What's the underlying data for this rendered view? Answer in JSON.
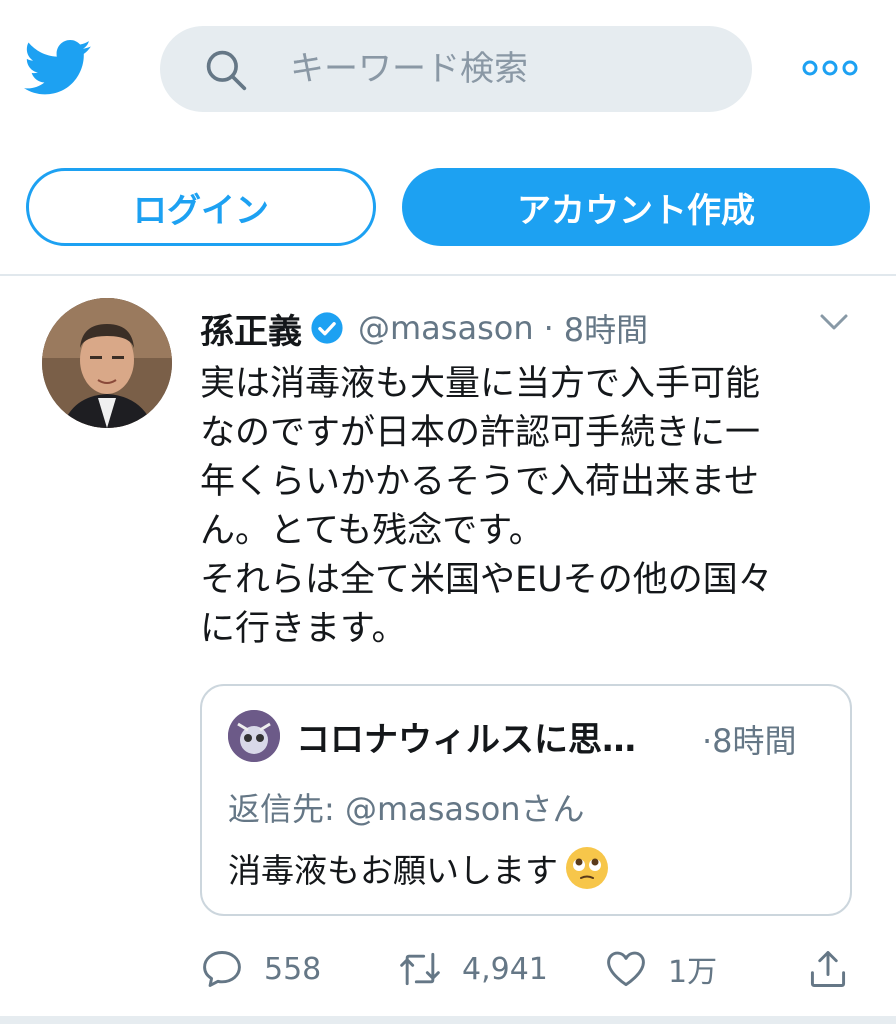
{
  "colors": {
    "brand": "#1da1f2",
    "text": "#14171a",
    "muted": "#657786"
  },
  "search": {
    "placeholder": "キーワード検索"
  },
  "buttons": {
    "login": "ログイン",
    "signup": "アカウント作成"
  },
  "tweet": {
    "name": "孫正義",
    "handle": "@masason",
    "separator": "·",
    "time": "8時間",
    "text": "実は消毒液も大量に当方で入手可能\nなのですが日本の許認可手続きに一\n年くらいかかるそうで入荷出来ませ\nん。とても残念です。\nそれらは全て米国やEUその他の国々\nに行きます。",
    "quote": {
      "name": "コロナウィルスに思…",
      "time": "·8時間",
      "reply_to": "返信先: @masasonさん",
      "text": "消毒液もお願いします"
    },
    "stats": {
      "replies": "558",
      "retweets": "4,941",
      "likes": "1万"
    }
  }
}
